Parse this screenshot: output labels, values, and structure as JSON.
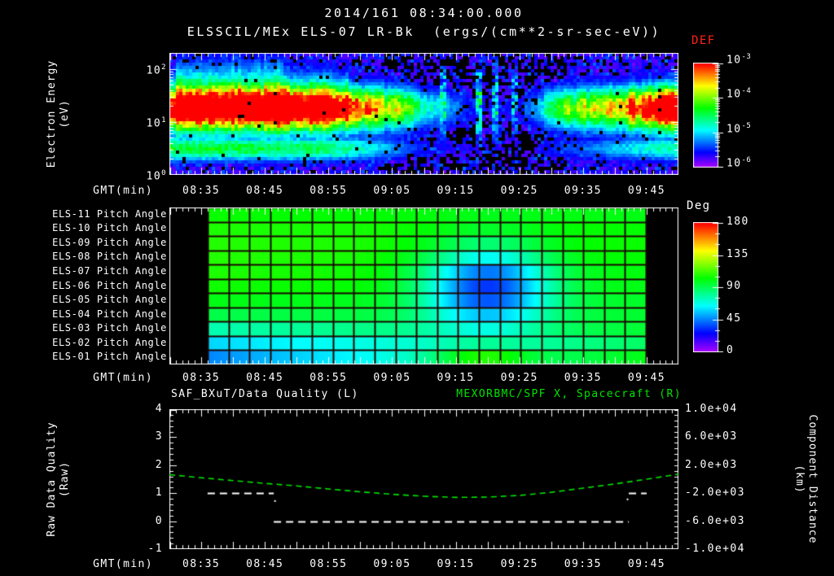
{
  "header": {
    "title_datetime": "2014/161 08:34:00.000",
    "title_instrument": "ELSSCIL/MEx ELS-07 LR-Bk  (ergs/(cm**2-sr-sec-eV))"
  },
  "colors": {
    "background": "#000000",
    "text": "#ffffff",
    "green_series": "#00e400",
    "def_title_red": "#ff2418",
    "pitch_grid": "#1b0500"
  },
  "time_axis": {
    "label": "GMT(min)",
    "start_of_axis": "08:30",
    "tick_labels": [
      "08:35",
      "08:45",
      "08:55",
      "09:05",
      "09:15",
      "09:25",
      "09:35",
      "09:45"
    ],
    "tick_minutes": [
      5,
      15,
      25,
      35,
      45,
      55,
      65,
      75
    ],
    "range_minutes": [
      0,
      80
    ]
  },
  "panels": {
    "spectrogram": {
      "y_label_lines": [
        "Electron Energy",
        "(eV)"
      ],
      "y_tick_exponents": [
        "2",
        "1",
        "0"
      ],
      "colorbar_title": "DEF",
      "colorbar_tick_exponents": [
        "-3",
        "-4",
        "-5",
        "-6"
      ]
    },
    "pitch": {
      "colorbar_title": "Deg",
      "colorbar_tick_labels": [
        "180",
        "135",
        "90",
        "45",
        "0"
      ]
    },
    "quality": {
      "left_title": "SAF_BXuT/Data Quality (L)",
      "right_title": "MEXORBMC/SPF X, Spacecraft (R)",
      "y_label_lines": [
        "Raw Data Quality",
        "(Raw)"
      ],
      "y_tick_labels": [
        "4",
        "3",
        "2",
        "1",
        "0",
        "-1"
      ],
      "right_y_label_lines": [
        "Component Distance",
        "(km)"
      ],
      "right_y_tick_labels": [
        "1.0e+04",
        "6.0e+03",
        "2.0e+03",
        "-2.0e+03",
        "-6.0e+03",
        "-1.0e+04"
      ]
    }
  },
  "chart_data": [
    {
      "type": "heatmap",
      "name": "electron_energy_spectrogram",
      "title": "ELSSCIL/MEx ELS-07 LR-Bk",
      "units": "ergs/(cm**2-sr-sec-eV)",
      "x_axis": "GMT(min)",
      "y_axis": "Electron Energy (eV)",
      "y_scale": "log",
      "y_range_ev": [
        1,
        200
      ],
      "colorbar_range_log10": [
        -6,
        -3
      ],
      "main_band_center_ev": 18,
      "low_band_center_ev": 3,
      "intensity_profile_minutes": [
        0,
        3,
        22,
        27,
        31,
        36,
        40,
        44,
        47,
        50,
        55,
        58,
        62,
        66,
        70,
        74,
        78,
        80
      ],
      "intensity_profile": [
        0.85,
        0.97,
        0.97,
        0.8,
        0.62,
        0.45,
        0.28,
        0.18,
        0.12,
        0.07,
        0.08,
        0.22,
        0.4,
        0.5,
        0.6,
        0.72,
        0.88,
        0.93
      ],
      "low_band_profile_minutes": [
        0,
        25,
        32,
        40,
        55,
        60,
        70,
        80
      ],
      "low_band_profile": [
        0.55,
        0.5,
        0.35,
        0.15,
        0.05,
        0.15,
        0.3,
        0.45
      ],
      "bright_streaks": [
        {
          "minute": 43.2,
          "amp": 0.55
        },
        {
          "minute": 48.6,
          "amp": 0.62
        },
        {
          "minute": 51.3,
          "amp": 0.58
        },
        {
          "minute": 54.2,
          "amp": 0.45
        }
      ]
    },
    {
      "type": "heatmap",
      "name": "pitch_angles",
      "colorbar_label": "Deg",
      "colorbar_range_deg": [
        0,
        180
      ],
      "data_minutes": [
        6,
        75
      ],
      "columns": 21,
      "rows_top_to_bottom": [
        {
          "label": "ELS-11 Pitch Angle",
          "start_deg": 104,
          "end_deg": 100
        },
        {
          "label": "ELS-10 Pitch Angle",
          "start_deg": 107,
          "end_deg": 103
        },
        {
          "label": "ELS-09 Pitch Angle",
          "start_deg": 108,
          "end_deg": 104
        },
        {
          "label": "ELS-08 Pitch Angle",
          "start_deg": 108,
          "end_deg": 103
        },
        {
          "label": "ELS-07 Pitch Angle",
          "start_deg": 107,
          "end_deg": 101
        },
        {
          "label": "ELS-06 Pitch Angle",
          "start_deg": 105,
          "end_deg": 100
        },
        {
          "label": "ELS-05 Pitch Angle",
          "start_deg": 100,
          "end_deg": 97
        },
        {
          "label": "ELS-04 Pitch Angle",
          "start_deg": 92,
          "end_deg": 96
        },
        {
          "label": "ELS-03 Pitch Angle",
          "start_deg": 76,
          "end_deg": 95
        },
        {
          "label": "ELS-02 Pitch Angle",
          "start_deg": 58,
          "end_deg": 88
        },
        {
          "label": "ELS-01 Pitch Angle",
          "start_deg": 46,
          "end_deg": 100
        }
      ],
      "depletion_blob": {
        "center_minute": 50,
        "center_row_from_top": 5,
        "delta_deg": -68,
        "sigma_minutes": 7,
        "sigma_rows": 1.9
      },
      "bottom_row_bright_bump": {
        "center_minute": 49,
        "delta_deg": 30,
        "sigma_minutes": 5.5
      }
    },
    {
      "type": "line",
      "name": "data_quality_and_spacecraft_distance",
      "left_series": {
        "label": "SAF_BXuT/Data Quality (L)",
        "style": "dashed",
        "y_axis": "Raw Data Quality (Raw)",
        "y_range": [
          -1,
          4
        ],
        "segments": [
          {
            "start_minute": 6.0,
            "end_minute": 16.4,
            "value": 1
          },
          {
            "start_minute": 16.4,
            "end_minute": 72.2,
            "value": 0
          },
          {
            "start_minute": 72.2,
            "end_minute": 75.0,
            "value": 1
          }
        ],
        "dots": [
          {
            "minute": 16.6,
            "value": 0.72
          },
          {
            "minute": 72.0,
            "value": 0.78
          }
        ]
      },
      "right_series": {
        "label": "MEXORBMC/SPF X, Spacecraft (R)",
        "style": "dashed",
        "y_axis": "Component Distance (km)",
        "y_range": [
          -10000,
          10000
        ],
        "minutes": [
          0,
          5,
          10,
          15,
          20,
          25,
          30,
          35,
          40,
          45,
          50,
          55,
          60,
          65,
          70,
          75,
          80
        ],
        "km": [
          640,
          200,
          -200,
          -600,
          -960,
          -1400,
          -1800,
          -2160,
          -2440,
          -2600,
          -2560,
          -2320,
          -1880,
          -1280,
          -680,
          0,
          720
        ]
      }
    }
  ]
}
